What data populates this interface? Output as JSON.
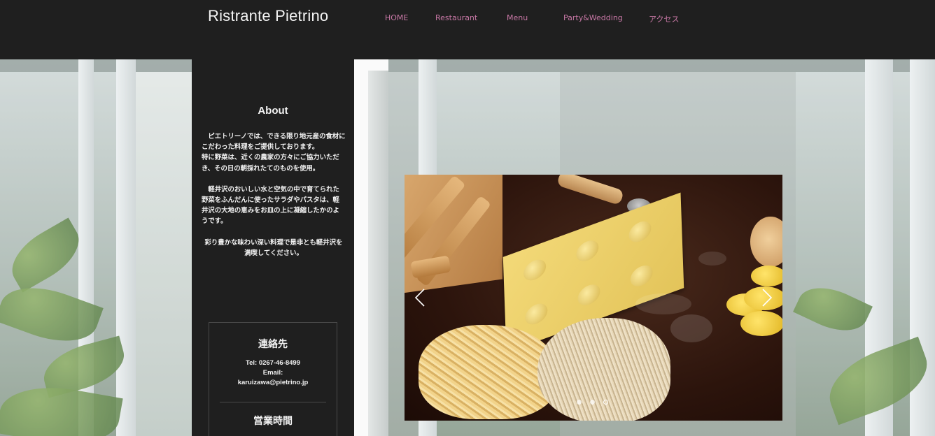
{
  "header": {
    "site_title": "Ristrante Pietrino",
    "nav": [
      {
        "label": "HOME"
      },
      {
        "label": "Restaurant"
      },
      {
        "label": "Menu"
      },
      {
        "label": "Party&Wedding"
      },
      {
        "label": "アクセス"
      }
    ]
  },
  "about": {
    "title": "About",
    "paragraphs": [
      "　ピエトリーノでは、できる限り地元産の食材にこだわった料理をご提供しております。",
      "特に野菜は、近くの農家の方々にご協力いただき、その日の朝採れたてのものを使用。",
      "　軽井沢のおいしい水と空気の中で育てられた野菜をふんだんに使ったサラダやパスタは、軽井沢の大地の恵みをお皿の上に凝縮したかのようです。",
      "彩り豊かな味わい深い料理で是非とも軽井沢を満喫してください。"
    ]
  },
  "contact": {
    "title": "連絡先",
    "tel": "Tel:  0267-46-8499",
    "email_label": "Email:",
    "email": "karuizawa@pietrino.jp",
    "hours_title": "営業時間"
  },
  "slideshow": {
    "image": "pasta-making-photo",
    "prev_icon": "chevron-left-icon",
    "next_icon": "chevron-right-icon",
    "dot_count": 3,
    "active_dot": 3
  },
  "colors": {
    "header_bg": "#1f1f1f",
    "nav_text": "#c878a6",
    "panel_bg": "#1f1f1f",
    "text_light": "#f2f2f2"
  }
}
